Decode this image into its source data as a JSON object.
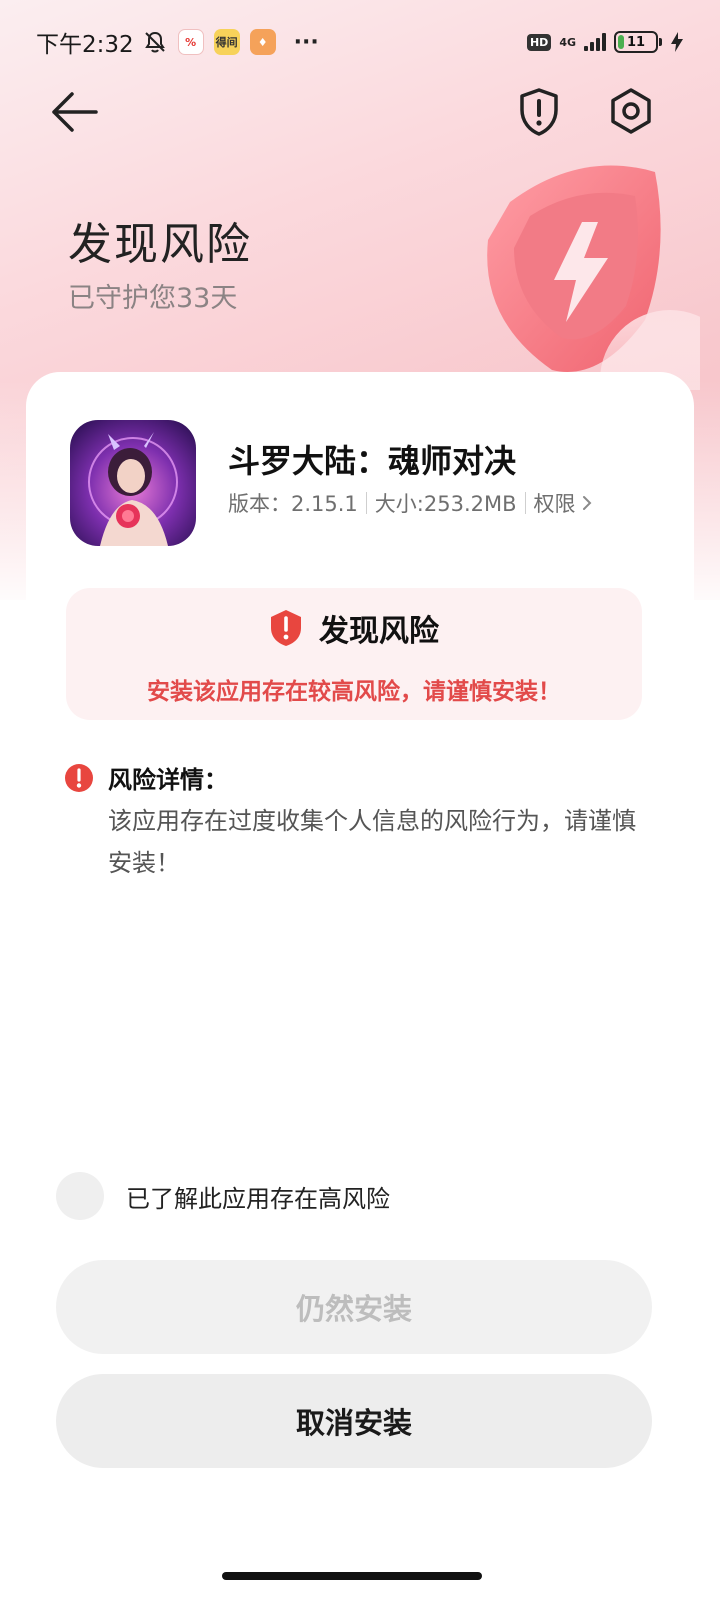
{
  "status_bar": {
    "time": "下午2:32",
    "apps": [
      {
        "name": "tomato-app",
        "glyph": "%",
        "color": "#e53935",
        "bg": "#ffffff"
      },
      {
        "name": "dedao-app",
        "glyph": "得间",
        "color": "#333333",
        "bg": "#f7d25a"
      },
      {
        "name": "home-app",
        "glyph": "♦",
        "color": "#ffffff",
        "bg": "#f5a25a"
      }
    ],
    "more": "···",
    "hd": "HD",
    "network": "4G",
    "battery_level": "11"
  },
  "colors": {
    "risk_red": "#e24a4a",
    "shield_red": "#e8463f",
    "hero_pink": "#f26d77"
  },
  "header": {
    "title": "发现风险",
    "subtitle": "已守护您33天"
  },
  "app_info": {
    "name": "斗罗大陆：魂师对决",
    "version": "版本：2.15.1",
    "size": "大小:253.2MB",
    "permissions": "权限"
  },
  "risk_box": {
    "title": "发现风险",
    "warning": "安装该应用存在较高风险，请谨慎安装！"
  },
  "details": {
    "title": "风险详情：",
    "text": "该应用存在过度收集个人信息的风险行为，请谨慎安装！"
  },
  "acknowledge": {
    "label": "已了解此应用存在高风险"
  },
  "buttons": {
    "install": "仍然安装",
    "cancel": "取消安装"
  }
}
